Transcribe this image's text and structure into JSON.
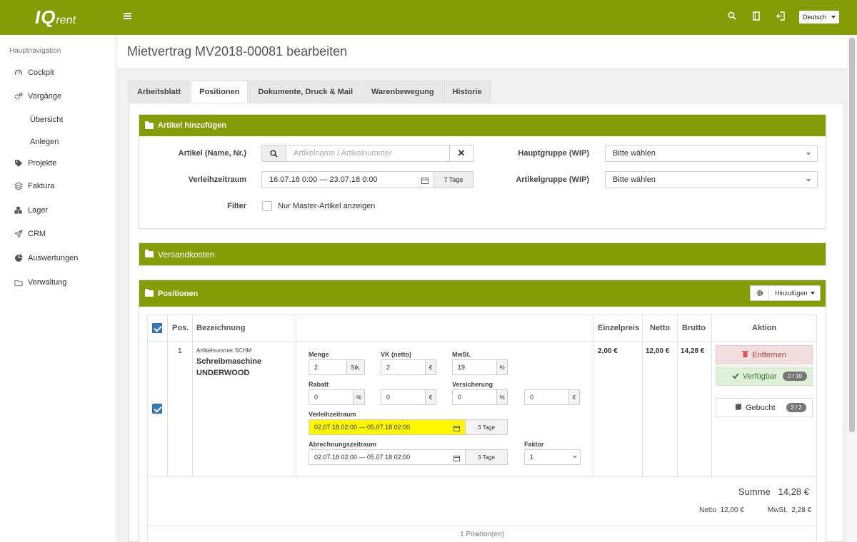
{
  "app": {
    "logo_main": "IQ",
    "logo_sub": "rent",
    "language": "Deutsch"
  },
  "colors": {
    "brand": "#849c06",
    "primary_checkbox": "#337ab7",
    "highlight": "#fff700"
  },
  "sidebar": {
    "heading": "Hauptnavigation",
    "items": [
      {
        "label": "Cockpit",
        "icon": "gauge-icon"
      },
      {
        "label": "Vorgänge",
        "icon": "gears-icon"
      },
      {
        "label": "Übersicht"
      },
      {
        "label": "Anlegen"
      },
      {
        "label": "Projekte",
        "icon": "tags-icon"
      },
      {
        "label": "Faktura",
        "icon": "layers-icon"
      },
      {
        "label": "Lager",
        "icon": "cubes-icon"
      },
      {
        "label": "CRM",
        "icon": "paper-plane-icon"
      },
      {
        "label": "Auswertungen",
        "icon": "pie-chart-icon"
      },
      {
        "label": "Verwaltung",
        "icon": "folder-icon"
      }
    ]
  },
  "page": {
    "title": "Mietvertrag MV2018-00081 bearbeiten"
  },
  "tabs": [
    "Arbeitsblatt",
    "Positionen",
    "Dokumente, Druck & Mail",
    "Warenbewegung",
    "Historie"
  ],
  "add_article": {
    "title": "Artikel hinzufügen",
    "article_label": "Artikel (Name, Nr.)",
    "article_placeholder": "Artikelname / Artikelnummer",
    "period_label": "Verleihzeitraum",
    "period_value": "16.07.18 0:00 — 23.07.18 0:00",
    "period_days": "7 Tage",
    "filter_label": "Filter",
    "filter_option": "Nur Master-Artikel anzeigen",
    "main_group_label": "Hauptgruppe (WIP)",
    "main_group_value": "Bitte wählen",
    "article_group_label": "Artikelgruppe (WIP)",
    "article_group_value": "Bitte wählen"
  },
  "shipping": {
    "title": "Versandkosten"
  },
  "positions": {
    "title": "Positionen",
    "add_button": "Hinzufügen",
    "headers": {
      "pos": "Pos.",
      "name": "Bezeichnung",
      "unit_price": "Einzelpreis",
      "net": "Netto",
      "gross": "Brutto",
      "action": "Aktion"
    },
    "row": {
      "pos": "1",
      "article_number": "Artikelnummer SCHM",
      "name_line1": "Schreibmaschine",
      "name_line2": "UNDERWOOD",
      "qty_label": "Menge",
      "qty_value": "2",
      "qty_unit": "Stk.",
      "vk_label": "VK (netto)",
      "vk_value": "2",
      "vk_unit": "€",
      "vat_label": "MwSt.",
      "vat_value": "19",
      "vat_unit": "%",
      "discount_label": "Rabatt",
      "discount_pct": "0",
      "discount_pct_unit": "%",
      "discount_abs": "0",
      "discount_abs_unit": "€",
      "insurance_label": "Versicherung",
      "insurance_pct": "0",
      "insurance_pct_unit": "%",
      "insurance_abs": "0",
      "insurance_abs_unit": "€",
      "rental_label": "Verleihzeitraum",
      "rental_value": "02.07.18 02:00 — 05.07.18 02:00",
      "rental_days": "3 Tage",
      "billing_label": "Abrechnungszeitraum",
      "billing_value": "02.07.18 02:00 — 05.07.18 02:00",
      "billing_days": "3 Tage",
      "factor_label": "Faktor",
      "factor_value": "1",
      "unit_price": "2,00 €",
      "net": "12,00 €",
      "gross": "14,28 €",
      "remove_label": "Entfernen",
      "available_label": "Verfügbar",
      "available_count": "0 / 10",
      "booked_label": "Gebucht",
      "booked_count": "2 / 2"
    },
    "sum_label": "Summe",
    "sum_value": "14,28 €",
    "net_label": "Netto",
    "net_value": "12,00 €",
    "vat_label": "MwSt.",
    "vat_value": "2,28 €",
    "count_text": "1 Position(en)"
  }
}
